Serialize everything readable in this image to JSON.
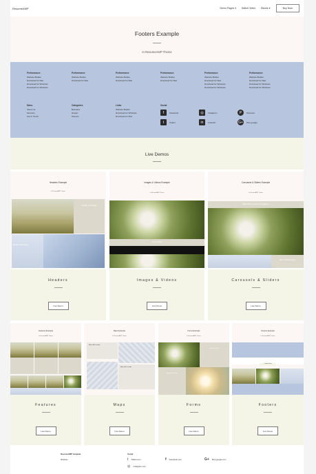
{
  "nav": {
    "brand": "ResumeAMP",
    "items": [
      "Demo Pages ▾",
      "Watch Video",
      "Blocks ▾"
    ],
    "buy": "Buy Now"
  },
  "hero": {
    "title": "Footers Example",
    "subtitle": "In ResumeAMP Theme"
  },
  "footer_demo": {
    "columns": [
      {
        "title": "Performance",
        "links": [
          "Website Builder",
          "Download for Mac",
          "Download for Windows",
          "Download for Windows"
        ]
      },
      {
        "title": "Performance",
        "links": [
          "Website Builder",
          "Download for Mac"
        ]
      },
      {
        "title": "Performance",
        "links": [
          "Website Builder",
          "Download for Mac"
        ]
      },
      {
        "title": "Performance",
        "links": [
          "Website Builder",
          "Download for Mac"
        ]
      },
      {
        "title": "Performance",
        "links": [
          "Website Builder",
          "Download for Mac",
          "Download for Windows",
          "Download for Windows"
        ]
      },
      {
        "title": "Performance",
        "links": [
          "Website Builder",
          "Download for Mac",
          "Download for Windows",
          "Download for Windows"
        ]
      }
    ],
    "columns2": [
      {
        "title": "Menu",
        "links": [
          "About Us",
          "Services",
          "Get In Touch"
        ]
      },
      {
        "title": "Categories",
        "links": [
          "Business",
          "Design",
          "Science"
        ]
      },
      {
        "title": "Links",
        "links": [
          "Website Builder",
          "Download for Windows",
          "Download for Mac"
        ]
      }
    ],
    "social_title": "Social",
    "social": [
      {
        "icon": "facebook-icon",
        "glyph": "f",
        "label": "Facebook"
      },
      {
        "icon": "instagram-icon",
        "glyph": "◎",
        "label": "Instagram"
      },
      {
        "icon": "pinterest-icon",
        "glyph": "P",
        "label": "Pinterest"
      },
      {
        "icon": "twitter-icon",
        "glyph": "t",
        "label": "Twitter"
      },
      {
        "icon": "linkedin-icon",
        "glyph": "in",
        "label": "LinkedIn"
      },
      {
        "icon": "googleplus-icon",
        "glyph": "G+",
        "label": "Plus google"
      }
    ]
  },
  "live_demos": {
    "title": "Live Demos",
    "cards": [
      {
        "label": "Headers",
        "thumb_title": "Headers Example",
        "thumb_sub": "In ResumeAMP Theme",
        "button": "Live Demo",
        "overlay1": "Header with Image",
        "overlay2": "Header with Image"
      },
      {
        "label": "Images & Videos",
        "thumb_title": "Images & Videos Example",
        "thumb_sub": "In ResumeAMP Theme",
        "button": "Live Demo",
        "overlay1": "Promo Video"
      },
      {
        "label": "Carousels & Sliders",
        "thumb_title": "Carousels & Sliders Example",
        "thumb_sub": "In ResumeAMP Theme",
        "button": "Live Demo",
        "overlay1": "Slider With Autoplay And Lightbox",
        "overlay2": "Slider With Autoplay"
      },
      {
        "label": "Features",
        "thumb_title": "Features Example",
        "thumb_sub": "In ResumeAMP Theme",
        "button": "Live Demo"
      },
      {
        "label": "Maps",
        "thumb_title": "Maps Example",
        "thumb_sub": "In ResumeAMP Theme",
        "button": "Live Demo",
        "overlay1": "Map with Location",
        "overlay2": "Map with Location"
      },
      {
        "label": "Forms",
        "thumb_title": "Forms Example",
        "thumb_sub": "In ResumeAMP Theme",
        "button": "Live Demo",
        "overlay1": "Newsletter Form",
        "overlay2": "Appointment Form"
      },
      {
        "label": "Footers",
        "thumb_title": "Footers Example",
        "thumb_sub": "In ResumeAMP Theme",
        "button": "Live Demo",
        "overlay1": "Contact Form"
      }
    ]
  },
  "page_footer": {
    "brand": "ResumeAMP template",
    "brand_sub": "Mobirise",
    "social_title": "Social",
    "links": [
      {
        "icon": "twitter-icon",
        "glyph": "t",
        "label": "Twitter.com"
      },
      {
        "icon": "facebook-icon",
        "glyph": "f",
        "label": "Facebook.com"
      },
      {
        "icon": "googleplus-icon",
        "glyph": "G+",
        "label": "Plus.google.com"
      },
      {
        "icon": "instagram-icon",
        "glyph": "◎",
        "label": "Instagram.com"
      }
    ]
  }
}
